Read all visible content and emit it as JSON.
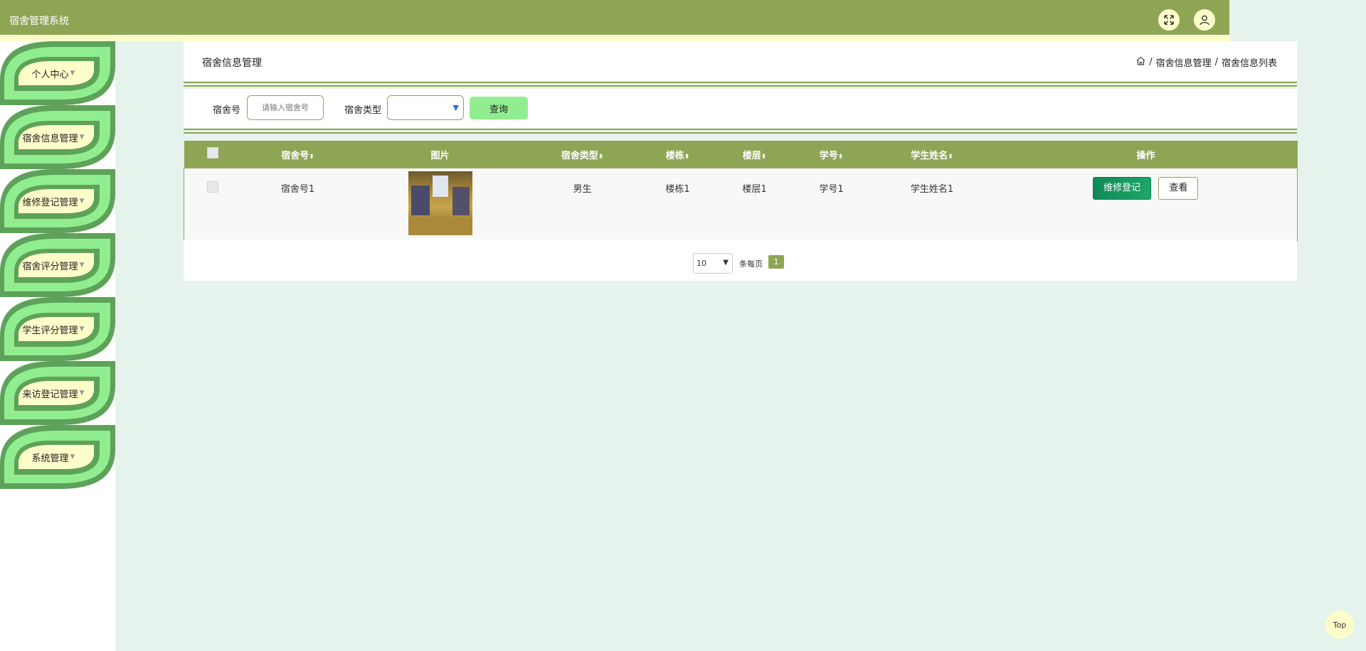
{
  "header": {
    "title": "宿舍管理系统"
  },
  "sidebar": {
    "items": [
      {
        "label": "个人中心"
      },
      {
        "label": "宿舍信息管理"
      },
      {
        "label": "维修登记管理"
      },
      {
        "label": "宿舍评分管理"
      },
      {
        "label": "学生评分管理"
      },
      {
        "label": "来访登记管理"
      },
      {
        "label": "系统管理"
      }
    ]
  },
  "page": {
    "title": "宿舍信息管理",
    "breadcrumb": [
      "宿舍信息管理",
      "宿舍信息列表"
    ]
  },
  "search": {
    "dorm_no_label": "宿舍号",
    "dorm_no_placeholder": "请输入宿舍号",
    "type_label": "宿舍类型",
    "type_value": "",
    "query_button": "查询"
  },
  "table": {
    "columns": [
      "宿舍号",
      "图片",
      "宿舍类型",
      "楼栋",
      "楼层",
      "学号",
      "学生姓名",
      "操作"
    ],
    "rows": [
      {
        "dorm_no": "宿舍号1",
        "type": "男生",
        "building": "楼栋1",
        "floor": "楼层1",
        "student_id": "学号1",
        "student_name": "学生姓名1",
        "actions": {
          "repair": "维修登记",
          "view": "查看"
        }
      }
    ]
  },
  "pagination": {
    "page_size": "10",
    "per_page_label": "条每页",
    "current_page": "1"
  },
  "back_to_top": "Top",
  "colors": {
    "primary": "#8fa556",
    "accent": "#fdfdca",
    "sidebar_green": "#90ee90",
    "background": "#e6f3ec"
  }
}
